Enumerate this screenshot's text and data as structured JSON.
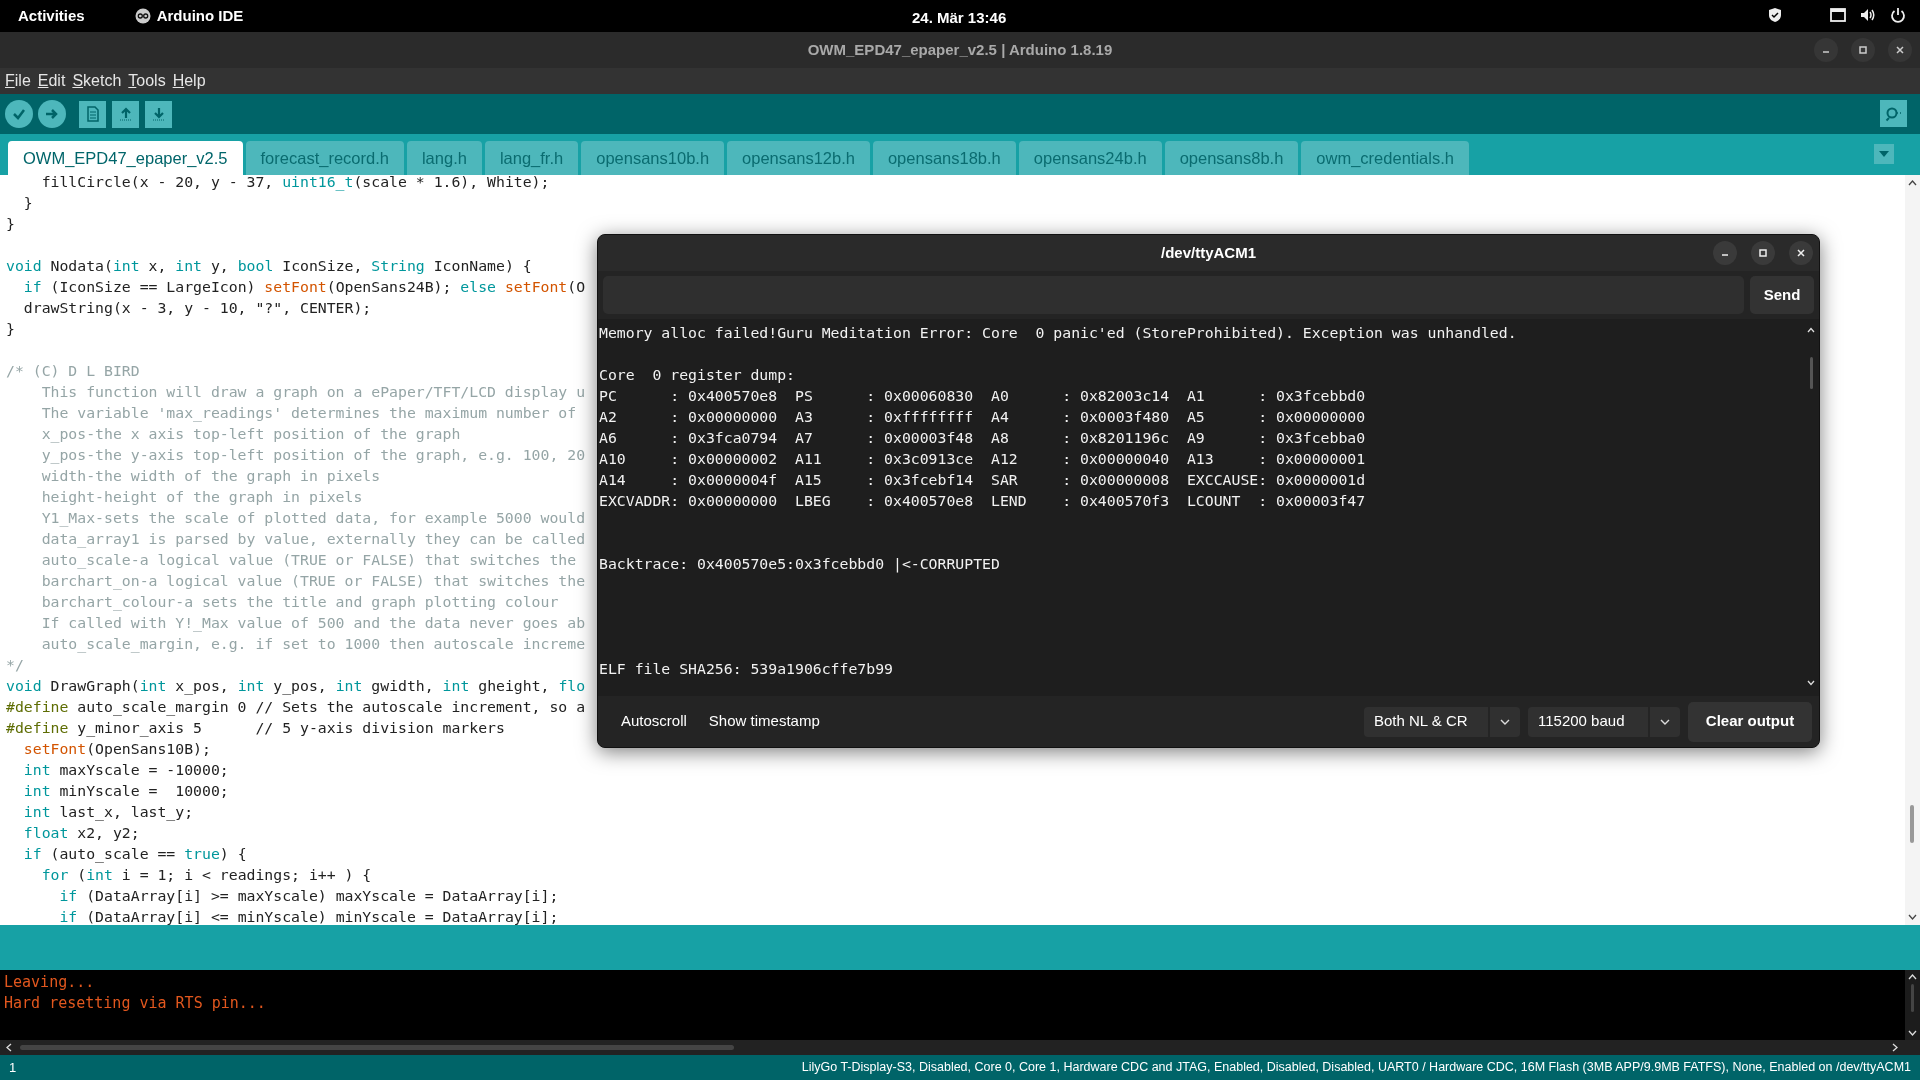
{
  "top_bar": {
    "activities": "Activities",
    "app_name": "Arduino IDE",
    "clock": "24. Mär  13:46"
  },
  "window": {
    "title": "OWM_EPD47_epaper_v2.5 | Arduino 1.8.19"
  },
  "menu": [
    "File",
    "Edit",
    "Sketch",
    "Tools",
    "Help"
  ],
  "tabs": [
    {
      "label": "OWM_EPD47_epaper_v2.5",
      "selected": true
    },
    {
      "label": "forecast_record.h",
      "selected": false
    },
    {
      "label": "lang.h",
      "selected": false
    },
    {
      "label": "lang_fr.h",
      "selected": false
    },
    {
      "label": "opensans10b.h",
      "selected": false
    },
    {
      "label": "opensans12b.h",
      "selected": false
    },
    {
      "label": "opensans18b.h",
      "selected": false
    },
    {
      "label": "opensans24b.h",
      "selected": false
    },
    {
      "label": "opensans8b.h",
      "selected": false
    },
    {
      "label": "owm_credentials.h",
      "selected": false
    }
  ],
  "editor": {
    "lines": [
      {
        "kind": "code",
        "tokens": [
          {
            "kind": "plain",
            "text": "    fillCircle(x - 20, y - 37, "
          },
          {
            "kind": "keyword",
            "text": "uint16_t"
          },
          {
            "kind": "plain",
            "text": "(scale * 1.6), White);"
          }
        ]
      },
      {
        "kind": "code",
        "tokens": [
          {
            "kind": "plain",
            "text": "  }"
          }
        ]
      },
      {
        "kind": "code",
        "tokens": [
          {
            "kind": "plain",
            "text": "}"
          }
        ]
      },
      {
        "kind": "blank"
      },
      {
        "kind": "code",
        "tokens": [
          {
            "kind": "keyword",
            "text": "void"
          },
          {
            "kind": "plain",
            "text": " Nodata("
          },
          {
            "kind": "keyword",
            "text": "int"
          },
          {
            "kind": "plain",
            "text": " x, "
          },
          {
            "kind": "keyword",
            "text": "int"
          },
          {
            "kind": "plain",
            "text": " y, "
          },
          {
            "kind": "keyword",
            "text": "bool"
          },
          {
            "kind": "plain",
            "text": " IconSize, "
          },
          {
            "kind": "keyword",
            "text": "String"
          },
          {
            "kind": "plain",
            "text": " IconName) {"
          }
        ]
      },
      {
        "kind": "code",
        "tokens": [
          {
            "kind": "keyword",
            "text": "  if"
          },
          {
            "kind": "plain",
            "text": " (IconSize == LargeIcon) "
          },
          {
            "kind": "function",
            "text": "setFont"
          },
          {
            "kind": "plain",
            "text": "(OpenSans24B); "
          },
          {
            "kind": "keyword",
            "text": "else "
          },
          {
            "kind": "function",
            "text": "setFont"
          },
          {
            "kind": "plain",
            "text": "(O"
          }
        ]
      },
      {
        "kind": "code",
        "tokens": [
          {
            "kind": "plain",
            "text": "  drawString(x - 3, y - 10, \"?\", CENTER);"
          }
        ]
      },
      {
        "kind": "code",
        "tokens": [
          {
            "kind": "plain",
            "text": "}"
          }
        ]
      },
      {
        "kind": "blank"
      },
      {
        "kind": "code",
        "tokens": [
          {
            "kind": "comment",
            "text": "/* (C) D L BIRD"
          }
        ]
      },
      {
        "kind": "code",
        "tokens": [
          {
            "kind": "comment",
            "text": "    This function will draw a graph on a ePaper/TFT/LCD display u"
          }
        ]
      },
      {
        "kind": "code",
        "tokens": [
          {
            "kind": "comment",
            "text": "    The variable 'max_readings' determines the maximum number of"
          }
        ]
      },
      {
        "kind": "code",
        "tokens": [
          {
            "kind": "comment",
            "text": "    x_pos-the x axis top-left position of the graph"
          }
        ]
      },
      {
        "kind": "code",
        "tokens": [
          {
            "kind": "comment",
            "text": "    y_pos-the y-axis top-left position of the graph, e.g. 100, 20"
          }
        ]
      },
      {
        "kind": "code",
        "tokens": [
          {
            "kind": "comment",
            "text": "    width-the width of the graph in pixels"
          }
        ]
      },
      {
        "kind": "code",
        "tokens": [
          {
            "kind": "comment",
            "text": "    height-height of the graph in pixels"
          }
        ]
      },
      {
        "kind": "code",
        "tokens": [
          {
            "kind": "comment",
            "text": "    Y1_Max-sets the scale of plotted data, for example 5000 would"
          }
        ]
      },
      {
        "kind": "code",
        "tokens": [
          {
            "kind": "comment",
            "text": "    data_array1 is parsed by value, externally they can be called"
          }
        ]
      },
      {
        "kind": "code",
        "tokens": [
          {
            "kind": "comment",
            "text": "    auto_scale-a logical value (TRUE or FALSE) that switches the"
          }
        ]
      },
      {
        "kind": "code",
        "tokens": [
          {
            "kind": "comment",
            "text": "    barchart_on-a logical value (TRUE or FALSE) that switches the"
          }
        ]
      },
      {
        "kind": "code",
        "tokens": [
          {
            "kind": "comment",
            "text": "    barchart_colour-a sets the title and graph plotting colour"
          }
        ]
      },
      {
        "kind": "code",
        "tokens": [
          {
            "kind": "comment",
            "text": "    If called with Y!_Max value of 500 and the data never goes ab"
          }
        ]
      },
      {
        "kind": "code",
        "tokens": [
          {
            "kind": "comment",
            "text": "    auto_scale_margin, e.g. if set to 1000 then autoscale increme"
          }
        ]
      },
      {
        "kind": "code",
        "tokens": [
          {
            "kind": "comment",
            "text": "*/"
          }
        ]
      },
      {
        "kind": "code",
        "tokens": [
          {
            "kind": "keyword",
            "text": "void"
          },
          {
            "kind": "plain",
            "text": " DrawGraph("
          },
          {
            "kind": "keyword",
            "text": "int"
          },
          {
            "kind": "plain",
            "text": " x_pos, "
          },
          {
            "kind": "keyword",
            "text": "int"
          },
          {
            "kind": "plain",
            "text": " y_pos, "
          },
          {
            "kind": "keyword",
            "text": "int"
          },
          {
            "kind": "plain",
            "text": " gwidth, "
          },
          {
            "kind": "keyword",
            "text": "int"
          },
          {
            "kind": "plain",
            "text": " gheight, "
          },
          {
            "kind": "keyword",
            "text": "flo"
          }
        ]
      },
      {
        "kind": "code",
        "tokens": [
          {
            "kind": "preprocessor",
            "text": "#define"
          },
          {
            "kind": "plain",
            "text": " auto_scale_margin 0 // Sets the autoscale increment, so a"
          }
        ]
      },
      {
        "kind": "code",
        "tokens": [
          {
            "kind": "preprocessor",
            "text": "#define"
          },
          {
            "kind": "plain",
            "text": " y_minor_axis 5      // 5 y-axis division markers"
          }
        ]
      },
      {
        "kind": "code",
        "tokens": [
          {
            "kind": "function",
            "text": "  setFont"
          },
          {
            "kind": "plain",
            "text": "(OpenSans10B);"
          }
        ]
      },
      {
        "kind": "code",
        "tokens": [
          {
            "kind": "keyword",
            "text": "  int"
          },
          {
            "kind": "plain",
            "text": " maxYscale = -10000;"
          }
        ]
      },
      {
        "kind": "code",
        "tokens": [
          {
            "kind": "keyword",
            "text": "  int"
          },
          {
            "kind": "plain",
            "text": " minYscale =  10000;"
          }
        ]
      },
      {
        "kind": "code",
        "tokens": [
          {
            "kind": "keyword",
            "text": "  int"
          },
          {
            "kind": "plain",
            "text": " last_x, last_y;"
          }
        ]
      },
      {
        "kind": "code",
        "tokens": [
          {
            "kind": "keyword",
            "text": "  float"
          },
          {
            "kind": "plain",
            "text": " x2, y2;"
          }
        ]
      },
      {
        "kind": "code",
        "tokens": [
          {
            "kind": "keyword",
            "text": "  if"
          },
          {
            "kind": "plain",
            "text": " (auto_scale == "
          },
          {
            "kind": "keyword",
            "text": "true"
          },
          {
            "kind": "plain",
            "text": ") {"
          }
        ]
      },
      {
        "kind": "code",
        "tokens": [
          {
            "kind": "keyword",
            "text": "    for"
          },
          {
            "kind": "plain",
            "text": " ("
          },
          {
            "kind": "keyword",
            "text": "int"
          },
          {
            "kind": "plain",
            "text": " i = 1; i < readings; i++ ) {"
          }
        ]
      },
      {
        "kind": "code",
        "tokens": [
          {
            "kind": "keyword",
            "text": "      if"
          },
          {
            "kind": "plain",
            "text": " (DataArray[i] >= maxYscale) maxYscale = DataArray[i];"
          }
        ]
      },
      {
        "kind": "code",
        "tokens": [
          {
            "kind": "keyword",
            "text": "      if"
          },
          {
            "kind": "plain",
            "text": " (DataArray[i] <= minYscale) minYscale = DataArray[i];"
          }
        ]
      }
    ]
  },
  "serial_monitor": {
    "title": "/dev/ttyACM1",
    "send": "Send",
    "output": [
      {
        "kind": "text",
        "text": "Memory alloc failed!Guru Meditation Error: Core  0 panic'ed (StoreProhibited). Exception was unhandled."
      },
      {
        "kind": "blank"
      },
      {
        "kind": "text",
        "text": "Core  0 register dump:"
      },
      {
        "kind": "text",
        "text": "PC      : 0x400570e8  PS      : 0x00060830  A0      : 0x82003c14  A1      : 0x3fcebbd0"
      },
      {
        "kind": "text",
        "text": "A2      : 0x00000000  A3      : 0xffffffff  A4      : 0x0003f480  A5      : 0x00000000"
      },
      {
        "kind": "text",
        "text": "A6      : 0x3fca0794  A7      : 0x00003f48  A8      : 0x8201196c  A9      : 0x3fcebba0"
      },
      {
        "kind": "text",
        "text": "A10     : 0x00000002  A11     : 0x3c0913ce  A12     : 0x00000040  A13     : 0x00000001"
      },
      {
        "kind": "text",
        "text": "A14     : 0x0000004f  A15     : 0x3fcebf14  SAR     : 0x00000008  EXCCAUSE: 0x0000001d"
      },
      {
        "kind": "text",
        "text": "EXCVADDR: 0x00000000  LBEG    : 0x400570e8  LEND    : 0x400570f3  LCOUNT  : 0x00003f47"
      },
      {
        "kind": "blank"
      },
      {
        "kind": "blank"
      },
      {
        "kind": "text",
        "text": "Backtrace: 0x400570e5:0x3fcebbd0 |<-CORRUPTED"
      },
      {
        "kind": "blank"
      },
      {
        "kind": "blank"
      },
      {
        "kind": "blank"
      },
      {
        "kind": "blank"
      },
      {
        "kind": "text",
        "text": "ELF file SHA256: 539a1906cffe7b99"
      }
    ],
    "autoscroll": "Autoscroll",
    "show_timestamp": "Show timestamp",
    "line_ending": "Both NL & CR",
    "baud": "115200 baud",
    "clear": "Clear output"
  },
  "console": {
    "lines": [
      "Leaving...",
      "Hard resetting via RTS pin..."
    ]
  },
  "status_bar": {
    "line": "1",
    "board": "LilyGo T-Display-S3, Disabled, Core 0, Core 1, Hardware CDC and JTAG, Enabled, Disabled, Disabled, UART0 / Hardware CDC, 16M Flash (3MB APP/9.9MB FATFS), None, Enabled on /dev/ttyACM1"
  }
}
